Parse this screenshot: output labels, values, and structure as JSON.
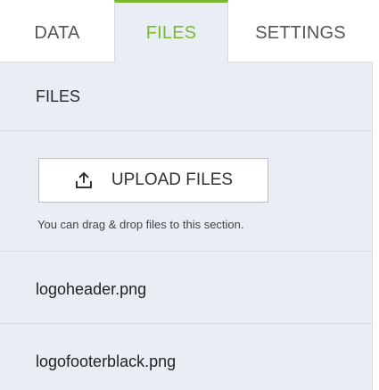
{
  "tabs": [
    {
      "label": "DATA",
      "active": false
    },
    {
      "label": "FILES",
      "active": true
    },
    {
      "label": "SETTINGS",
      "active": false
    }
  ],
  "files_section": {
    "title": "FILES",
    "upload_label": "UPLOAD FILES",
    "upload_icon": "upload-icon",
    "hint": "You can drag & drop files to this section.",
    "files": [
      {
        "name": "logoheader.png"
      },
      {
        "name": "logofooterblack.png"
      }
    ]
  },
  "colors": {
    "accent": "#7cb82f",
    "panel_bg": "#e8eef3",
    "divider": "#d6dee5"
  }
}
